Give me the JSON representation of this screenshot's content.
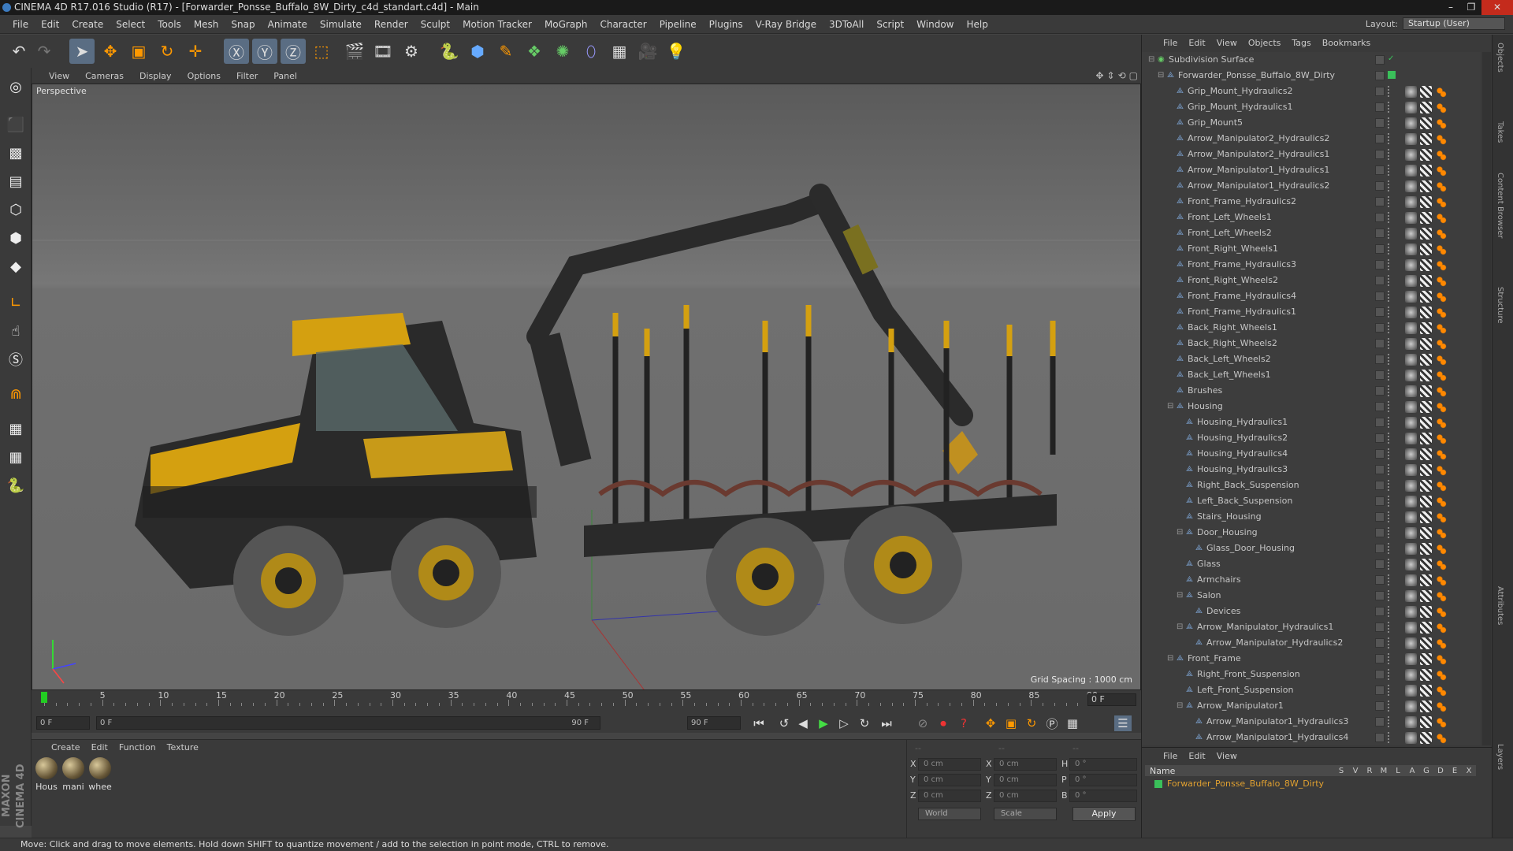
{
  "window": {
    "title": "CINEMA 4D R17.016 Studio (R17) - [Forwarder_Ponsse_Buffalo_8W_Dirty_c4d_standart.c4d] - Main",
    "controls": [
      "–",
      "❐",
      "✕"
    ]
  },
  "menubar": [
    "File",
    "Edit",
    "Create",
    "Select",
    "Tools",
    "Mesh",
    "Snap",
    "Animate",
    "Simulate",
    "Render",
    "Sculpt",
    "Motion Tracker",
    "MoGraph",
    "Character",
    "Pipeline",
    "Plugins",
    "V-Ray Bridge",
    "3DToAll",
    "Script",
    "Window",
    "Help"
  ],
  "layout": {
    "label": "Layout:",
    "value": "Startup (User)"
  },
  "viewport": {
    "menu": [
      "View",
      "Cameras",
      "Display",
      "Options",
      "Filter",
      "Panel"
    ],
    "label": "Perspective",
    "grid_spacing": "Grid Spacing : 1000 cm"
  },
  "timeline": {
    "ticks": [
      "0",
      "5",
      "10",
      "15",
      "20",
      "25",
      "30",
      "35",
      "40",
      "45",
      "50",
      "55",
      "60",
      "65",
      "70",
      "75",
      "80",
      "85",
      "90"
    ],
    "current_frame": "0 F"
  },
  "transport": {
    "start": "0 F",
    "range_start": "0 F",
    "range_end": "90 F",
    "end": "90 F"
  },
  "materials": {
    "menu": [
      "Create",
      "Edit",
      "Function",
      "Texture"
    ],
    "items": [
      "Hous",
      "mani",
      "whee"
    ]
  },
  "coords": {
    "x": "0 cm",
    "y": "0 cm",
    "z": "0 cm",
    "sx": "0 cm",
    "sy": "0 cm",
    "sz": "0 cm",
    "h": "0 °",
    "p": "0 °",
    "b": "0 °",
    "mode": "World",
    "scale": "Scale",
    "apply": "Apply",
    "dashes": "--"
  },
  "object_manager": {
    "menu": [
      "File",
      "Edit",
      "View",
      "Objects",
      "Tags",
      "Bookmarks"
    ],
    "objects": [
      {
        "name": "Subdivision Surface",
        "indent": 0
      },
      {
        "name": "Forwarder_Ponsse_Buffalo_8W_Dirty",
        "indent": 1
      },
      {
        "name": "Grip_Mount_Hydraulics2",
        "indent": 2
      },
      {
        "name": "Grip_Mount_Hydraulics1",
        "indent": 2
      },
      {
        "name": "Grip_Mount5",
        "indent": 2
      },
      {
        "name": "Arrow_Manipulator2_Hydraulics2",
        "indent": 2
      },
      {
        "name": "Arrow_Manipulator2_Hydraulics1",
        "indent": 2
      },
      {
        "name": "Arrow_Manipulator1_Hydraulics1",
        "indent": 2
      },
      {
        "name": "Arrow_Manipulator1_Hydraulics2",
        "indent": 2
      },
      {
        "name": "Front_Frame_Hydraulics2",
        "indent": 2
      },
      {
        "name": "Front_Left_Wheels1",
        "indent": 2
      },
      {
        "name": "Front_Left_Wheels2",
        "indent": 2
      },
      {
        "name": "Front_Right_Wheels1",
        "indent": 2
      },
      {
        "name": "Front_Frame_Hydraulics3",
        "indent": 2
      },
      {
        "name": "Front_Right_Wheels2",
        "indent": 2
      },
      {
        "name": "Front_Frame_Hydraulics4",
        "indent": 2
      },
      {
        "name": "Front_Frame_Hydraulics1",
        "indent": 2
      },
      {
        "name": "Back_Right_Wheels1",
        "indent": 2
      },
      {
        "name": "Back_Right_Wheels2",
        "indent": 2
      },
      {
        "name": "Back_Left_Wheels2",
        "indent": 2
      },
      {
        "name": "Back_Left_Wheels1",
        "indent": 2
      },
      {
        "name": "Brushes",
        "indent": 2
      },
      {
        "name": "Housing",
        "indent": 2
      },
      {
        "name": "Housing_Hydraulics1",
        "indent": 3
      },
      {
        "name": "Housing_Hydraulics2",
        "indent": 3
      },
      {
        "name": "Housing_Hydraulics4",
        "indent": 3
      },
      {
        "name": "Housing_Hydraulics3",
        "indent": 3
      },
      {
        "name": "Right_Back_Suspension",
        "indent": 3
      },
      {
        "name": "Left_Back_Suspension",
        "indent": 3
      },
      {
        "name": "Stairs_Housing",
        "indent": 3
      },
      {
        "name": "Door_Housing",
        "indent": 3
      },
      {
        "name": "Glass_Door_Housing",
        "indent": 4
      },
      {
        "name": "Glass",
        "indent": 3
      },
      {
        "name": "Armchairs",
        "indent": 3
      },
      {
        "name": "Salon",
        "indent": 3
      },
      {
        "name": "Devices",
        "indent": 4
      },
      {
        "name": "Arrow_Manipulator_Hydraulics1",
        "indent": 3
      },
      {
        "name": "Arrow_Manipulator_Hydraulics2",
        "indent": 4
      },
      {
        "name": "Front_Frame",
        "indent": 2
      },
      {
        "name": "Right_Front_Suspension",
        "indent": 3
      },
      {
        "name": "Left_Front_Suspension",
        "indent": 3
      },
      {
        "name": "Arrow_Manipulator1",
        "indent": 3
      },
      {
        "name": "Arrow_Manipulator1_Hydraulics3",
        "indent": 4
      },
      {
        "name": "Arrow_Manipulator1_Hydraulics4",
        "indent": 4
      }
    ]
  },
  "attribute_manager": {
    "menu": [
      "File",
      "Edit",
      "View"
    ],
    "columns": [
      "S",
      "V",
      "R",
      "M",
      "L",
      "A",
      "G",
      "D",
      "E",
      "X"
    ],
    "name_header": "Name",
    "layer_name": "Forwarder_Ponsse_Buffalo_8W_Dirty"
  },
  "right_tabs": [
    "Objects",
    "Takes",
    "Content Browser",
    "Structure",
    "Attributes",
    "Layers"
  ],
  "status": "Move: Click and drag to move elements. Hold down SHIFT to quantize movement / add to the selection in point mode, CTRL to remove.",
  "brand": "MAXON CINEMA 4D",
  "colors": {
    "accent": "#5a6d83",
    "layer_name": "#e0a030",
    "green_tag": "#3ac05a"
  }
}
